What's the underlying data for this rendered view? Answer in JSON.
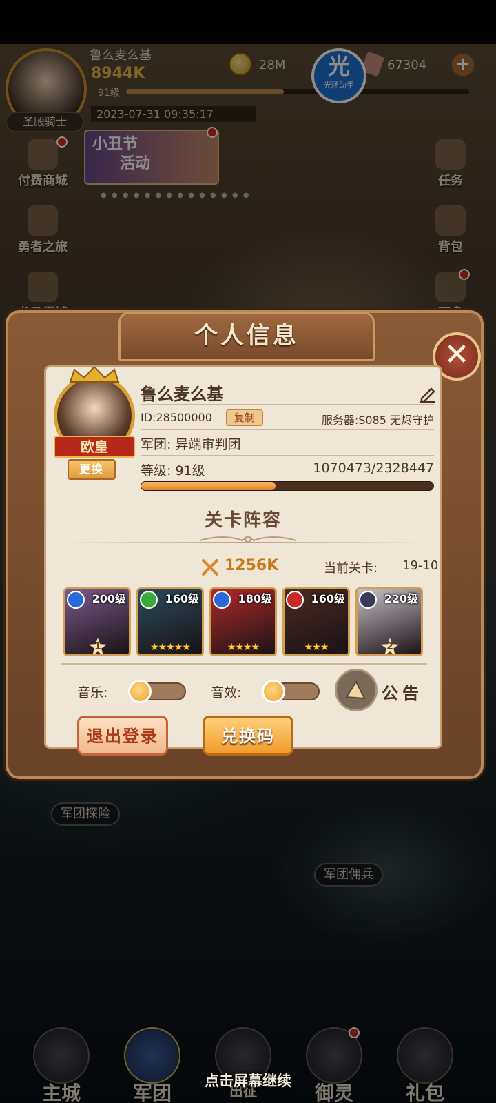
{
  "hud": {
    "player_name": "鲁么麦么基",
    "power": "8944K",
    "level": "91级",
    "level_progress": 0.46,
    "datetime": "2023-07-31 09:35:17",
    "title": "圣殿骑士",
    "gold": "28M",
    "gems": "67304",
    "plus": "+",
    "watermark_main": "光",
    "watermark_sub": "光环助手"
  },
  "left_menu": [
    {
      "label": "付费商城",
      "icon": "shop-icon"
    },
    {
      "label": "勇者之旅",
      "icon": "scroll-icon"
    },
    {
      "label": "龙骨界域",
      "icon": "dragon-icon"
    }
  ],
  "right_menu": [
    {
      "label": "任务",
      "icon": "quest-icon"
    },
    {
      "label": "背包",
      "icon": "bag-icon"
    },
    {
      "label": "更多",
      "icon": "more-icon"
    }
  ],
  "event_banner": {
    "line1": "小丑节",
    "line2": "活动"
  },
  "modal": {
    "title": "个人信息",
    "close": "✕",
    "name": "鲁么麦么基",
    "id": "ID:28500000",
    "copy": "复制",
    "server": "服务器:S085 无烬守护",
    "guild": "军团: 异端审判团",
    "level": "等级: 91级",
    "exp": "1070473/2328447",
    "exp_progress": 0.46,
    "rank_badge": "欧皇",
    "change": "更换",
    "section_title": "关卡阵容",
    "team_power": "1256K",
    "stage_label": "当前关卡:",
    "stage_value": "19-10",
    "heroes": [
      {
        "level": "200级",
        "element_color": "#2a6ad8",
        "bg": "#7a5a8a",
        "stars": "",
        "rank": "1"
      },
      {
        "level": "160级",
        "element_color": "#3aa83a",
        "bg": "#2a4a5a",
        "stars": "★★★★★",
        "rank": ""
      },
      {
        "level": "180级",
        "element_color": "#2a6ad8",
        "bg": "#b02a2a",
        "stars": "★★★★",
        "rank": ""
      },
      {
        "level": "160级",
        "element_color": "#c82a2a",
        "bg": "#4a2a22",
        "stars": "★★★",
        "rank": ""
      },
      {
        "level": "220级",
        "element_color": "#3a3a5a",
        "bg": "#c8c0c8",
        "stars": "",
        "rank": "2"
      }
    ],
    "music_label": "音乐:",
    "sfx_label": "音效:",
    "notice_label": "公告",
    "logout": "退出登录",
    "redeem": "兑换码"
  },
  "map_tags": {
    "guild_explore": "军团探险",
    "guild_mercenary": "军团佣兵"
  },
  "bottom_nav": [
    {
      "label": "主城"
    },
    {
      "label": "军团"
    },
    {
      "label": "出征"
    },
    {
      "label": "御灵"
    },
    {
      "label": "礼包"
    }
  ],
  "continue_hint": "点击屏幕继续"
}
